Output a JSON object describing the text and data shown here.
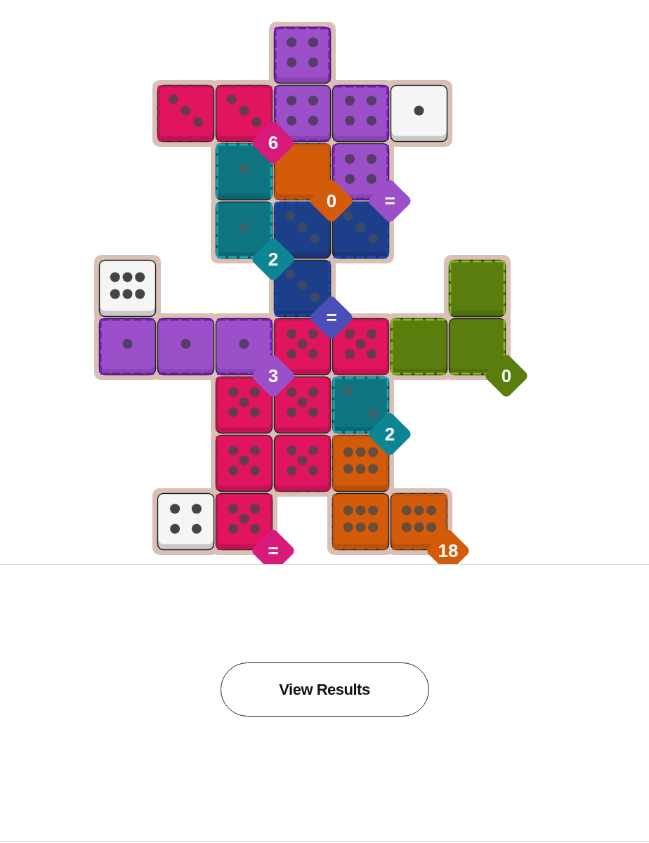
{
  "board": {
    "rows": [
      [
        {
          "kind": "empty"
        },
        {
          "kind": "empty"
        },
        {
          "kind": "empty"
        },
        {
          "kind": "four",
          "color": "#9b4fc9"
        },
        {
          "kind": "empty"
        },
        {
          "kind": "empty"
        },
        {
          "kind": "empty"
        }
      ],
      [
        {
          "kind": "empty"
        },
        {
          "kind": "three",
          "color": "#e0145f"
        },
        {
          "kind": "three",
          "color": "#e0145f",
          "badge": {
            "label": "6",
            "color": "#d81b7a"
          }
        },
        {
          "kind": "four",
          "color": "#9b4fc9"
        },
        {
          "kind": "four",
          "color": "#9b4fc9"
        },
        {
          "kind": "one"
        },
        {
          "kind": "empty"
        }
      ],
      [
        {
          "kind": "empty"
        },
        {
          "kind": "empty"
        },
        {
          "kind": "one",
          "color": "#0d7480"
        },
        {
          "kind": "blank",
          "color": "#d35b0a",
          "badge": {
            "label": "0",
            "color": "#d35b0a"
          }
        },
        {
          "kind": "four",
          "color": "#9b4fc9",
          "badge": {
            "label": "=",
            "color": "#9b4fc9"
          }
        },
        {
          "kind": "empty"
        },
        {
          "kind": "empty"
        }
      ],
      [
        {
          "kind": "empty"
        },
        {
          "kind": "empty"
        },
        {
          "kind": "one",
          "color": "#0d7480",
          "badge": {
            "label": "2",
            "color": "#0e8592"
          }
        },
        {
          "kind": "three",
          "color": "#1d3f8a"
        },
        {
          "kind": "three",
          "color": "#1d3f8a"
        },
        {
          "kind": "empty"
        },
        {
          "kind": "empty"
        }
      ],
      [
        {
          "kind": "six"
        },
        {
          "kind": "empty"
        },
        {
          "kind": "empty"
        },
        {
          "kind": "three",
          "color": "#1d3f8a",
          "badge": {
            "label": "=",
            "color": "#4a4fb8"
          }
        },
        {
          "kind": "empty"
        },
        {
          "kind": "empty"
        },
        {
          "kind": "blank",
          "color": "#5a7d0e"
        }
      ],
      [
        {
          "kind": "one",
          "color": "#9b4fc9"
        },
        {
          "kind": "one",
          "color": "#9b4fc9"
        },
        {
          "kind": "one",
          "color": "#9b4fc9",
          "badge": {
            "label": "3",
            "color": "#9b4fc9"
          }
        },
        {
          "kind": "five",
          "color": "#e0145f"
        },
        {
          "kind": "five",
          "color": "#e0145f"
        },
        {
          "kind": "blank",
          "color": "#5a7d0e"
        },
        {
          "kind": "blank",
          "color": "#5a7d0e",
          "badge": {
            "label": "0",
            "color": "#5a7d0e"
          }
        }
      ],
      [
        {
          "kind": "empty"
        },
        {
          "kind": "empty"
        },
        {
          "kind": "five",
          "color": "#e0145f"
        },
        {
          "kind": "five",
          "color": "#e0145f"
        },
        {
          "kind": "two",
          "color": "#0d7480",
          "badge": {
            "label": "2",
            "color": "#0e8592"
          }
        },
        {
          "kind": "empty"
        },
        {
          "kind": "empty"
        }
      ],
      [
        {
          "kind": "empty"
        },
        {
          "kind": "empty"
        },
        {
          "kind": "five",
          "color": "#e0145f"
        },
        {
          "kind": "five",
          "color": "#e0145f"
        },
        {
          "kind": "six",
          "color": "#d35b0a"
        },
        {
          "kind": "empty"
        },
        {
          "kind": "empty"
        }
      ],
      [
        {
          "kind": "empty"
        },
        {
          "kind": "four"
        },
        {
          "kind": "five",
          "color": "#e0145f",
          "badge": {
            "label": "=",
            "color": "#d81b7a"
          }
        },
        {
          "kind": "empty"
        },
        {
          "kind": "six",
          "color": "#d35b0a"
        },
        {
          "kind": "six",
          "color": "#d35b0a",
          "badge": {
            "label": "18",
            "color": "#d35b0a"
          }
        },
        {
          "kind": "empty"
        }
      ]
    ]
  },
  "button": "View Results"
}
